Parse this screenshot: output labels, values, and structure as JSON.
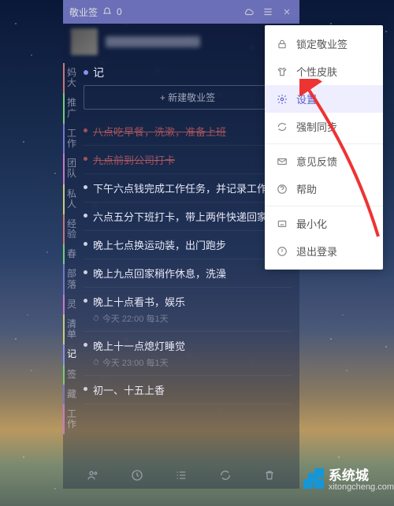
{
  "titlebar": {
    "app_name": "敬业签",
    "notif_count": "0"
  },
  "section": {
    "title": "记"
  },
  "newbox": {
    "placeholder": "+ 新建敬业签"
  },
  "sidebar_tabs": [
    "妈大",
    "推广",
    "工作",
    "团队",
    "私人",
    "经验",
    "春",
    "部落",
    "灵",
    "清单",
    "记",
    "签",
    "藏",
    "工作"
  ],
  "notes": [
    {
      "text": "八点吃早餐，洗漱，准备上班",
      "completed": true
    },
    {
      "text": "九点前到公司打卡",
      "completed": true
    },
    {
      "text": "下午六点钱完成工作任务，并记录工作"
    },
    {
      "text": "六点五分下班打卡，带上两件快递回家。"
    },
    {
      "text": "晚上七点换运动装，出门跑步"
    },
    {
      "text": "晚上九点回家稍作休息，洗澡"
    },
    {
      "text": "晚上十点看书，娱乐",
      "meta": "今天 22:00 每1天"
    },
    {
      "text": "晚上十一点熄灯睡觉",
      "meta": "今天 23:00 每1天"
    },
    {
      "text": "初一、十五上香"
    }
  ],
  "menu": [
    {
      "icon": "lock",
      "label": "锁定敬业签"
    },
    {
      "icon": "shirt",
      "label": "个性皮肤"
    },
    {
      "icon": "gear",
      "label": "设置",
      "highlight": true
    },
    {
      "icon": "sync",
      "label": "强制同步"
    },
    {
      "sep": true
    },
    {
      "icon": "mail",
      "label": "意见反馈"
    },
    {
      "icon": "help",
      "label": "帮助"
    },
    {
      "sep": true
    },
    {
      "icon": "min",
      "label": "最小化"
    },
    {
      "icon": "exit",
      "label": "退出登录"
    }
  ],
  "watermark": {
    "name": "系统城",
    "url": "xitongcheng.com"
  }
}
